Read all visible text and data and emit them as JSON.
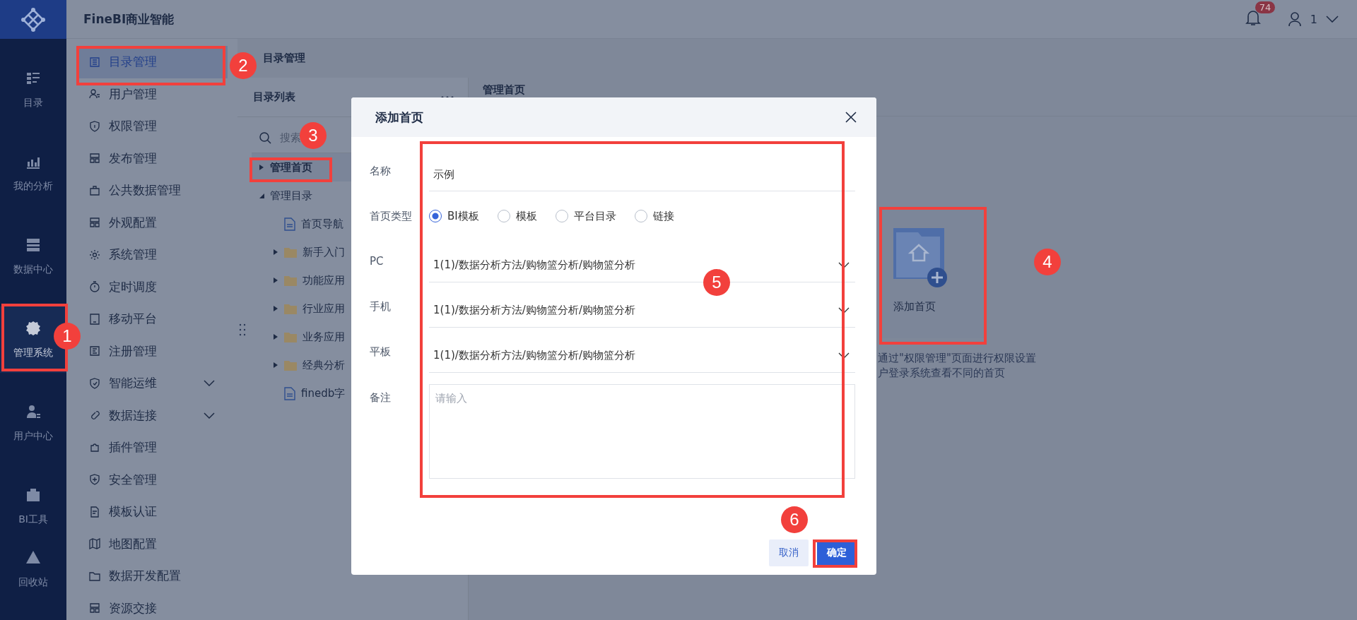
{
  "app": {
    "title": "FineBI商业智能"
  },
  "header": {
    "notification_count": "74",
    "user": "1"
  },
  "nav_rail": [
    {
      "label": "目录",
      "selected": false
    },
    {
      "label": "我的分析",
      "selected": false
    },
    {
      "label": "数据中心",
      "selected": false
    },
    {
      "label": "管理系统",
      "selected": true
    },
    {
      "label": "用户中心",
      "selected": false
    },
    {
      "label": "BI工具",
      "selected": false
    },
    {
      "label": "回收站",
      "selected": false
    }
  ],
  "sidebar": {
    "items": [
      {
        "label": "目录管理",
        "selected": true,
        "expandable": false
      },
      {
        "label": "用户管理",
        "selected": false,
        "expandable": false
      },
      {
        "label": "权限管理",
        "selected": false,
        "expandable": false
      },
      {
        "label": "发布管理",
        "selected": false,
        "expandable": false
      },
      {
        "label": "公共数据管理",
        "selected": false,
        "expandable": false
      },
      {
        "label": "外观配置",
        "selected": false,
        "expandable": false
      },
      {
        "label": "系统管理",
        "selected": false,
        "expandable": false
      },
      {
        "label": "定时调度",
        "selected": false,
        "expandable": false
      },
      {
        "label": "移动平台",
        "selected": false,
        "expandable": false
      },
      {
        "label": "注册管理",
        "selected": false,
        "expandable": false
      },
      {
        "label": "智能运维",
        "selected": false,
        "expandable": true
      },
      {
        "label": "数据连接",
        "selected": false,
        "expandable": true
      },
      {
        "label": "插件管理",
        "selected": false,
        "expandable": false
      },
      {
        "label": "安全管理",
        "selected": false,
        "expandable": false
      },
      {
        "label": "模板认证",
        "selected": false,
        "expandable": false
      },
      {
        "label": "地图配置",
        "selected": false,
        "expandable": false
      },
      {
        "label": "数据开发配置",
        "selected": false,
        "expandable": false
      },
      {
        "label": "资源交接",
        "selected": false,
        "expandable": false
      }
    ]
  },
  "breadcrumb": "目录管理",
  "catalog_panel": {
    "title": "目录列表",
    "search": {
      "placeholder": "搜索"
    },
    "tree": [
      {
        "label": "管理首页",
        "kind": "node",
        "selected": true,
        "expanded": false
      },
      {
        "label": "管理目录",
        "kind": "node",
        "selected": false,
        "expanded": true,
        "children": [
          {
            "label": "首页导航",
            "kind": "file"
          },
          {
            "label": "新手入门",
            "kind": "folder",
            "expanded": false
          },
          {
            "label": "功能应用",
            "kind": "folder",
            "expanded": false
          },
          {
            "label": "行业应用",
            "kind": "folder",
            "expanded": false
          },
          {
            "label": "业务应用",
            "kind": "folder",
            "expanded": false
          },
          {
            "label": "经典分析",
            "kind": "folder",
            "expanded": false
          },
          {
            "label": "finedb字",
            "kind": "file"
          }
        ]
      }
    ]
  },
  "home_panel": {
    "title": "管理首页",
    "add_card": {
      "label": "添加首页"
    },
    "hint_lines": [
      "通过\"权限管理\"页面进行权限设置",
      "户登录系统查看不同的首页"
    ]
  },
  "dialog": {
    "title": "添加首页",
    "fields": [
      {
        "kind": "text",
        "label": "名称",
        "value": "示例"
      },
      {
        "kind": "radio",
        "label": "首页类型",
        "options": [
          {
            "label": "BI模板",
            "selected": true
          },
          {
            "label": "模板",
            "selected": false
          },
          {
            "label": "平台目录",
            "selected": false
          },
          {
            "label": "链接",
            "selected": false
          }
        ]
      },
      {
        "kind": "select",
        "label": "PC",
        "value": "1(1)/数据分析方法/购物篮分析/购物篮分析"
      },
      {
        "kind": "select",
        "label": "手机",
        "value": "1(1)/数据分析方法/购物篮分析/购物篮分析"
      },
      {
        "kind": "select",
        "label": "平板",
        "value": "1(1)/数据分析方法/购物篮分析/购物篮分析"
      },
      {
        "kind": "textarea",
        "label": "备注",
        "placeholder": "请输入"
      }
    ],
    "buttons": [
      {
        "label": "取消",
        "kind": "secondary"
      },
      {
        "label": "确定",
        "kind": "primary"
      }
    ]
  },
  "annotations": [
    {
      "number": "1"
    },
    {
      "number": "2"
    },
    {
      "number": "3"
    },
    {
      "number": "4"
    },
    {
      "number": "5"
    },
    {
      "number": "6"
    }
  ]
}
